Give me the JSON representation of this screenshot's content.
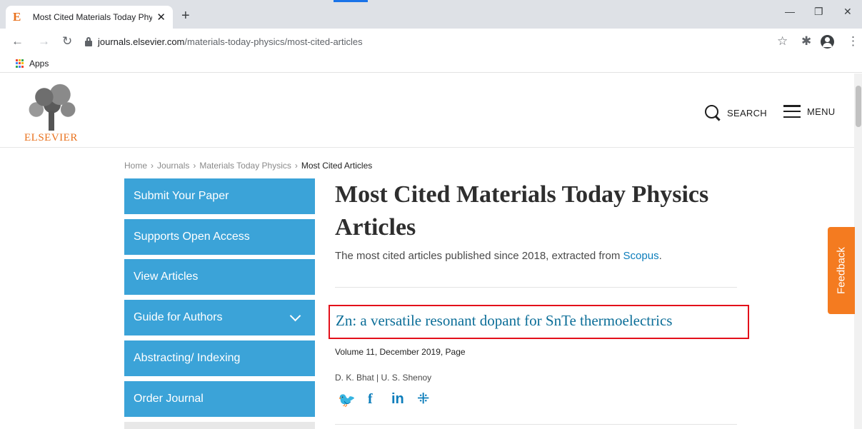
{
  "browser": {
    "tab_title": "Most Cited Materials Today Physi",
    "tab_favicon": "E",
    "new_tab": "+",
    "close": "✕",
    "url_host": "journals.elsevier.com",
    "url_path": "/materials-today-physics/most-cited-articles",
    "bookmark_apps": "Apps",
    "icons": [
      "back-arrow-icon",
      "forward-arrow-icon",
      "reload-icon",
      "lock-icon",
      "star-icon",
      "extensions-icon",
      "profile-icon",
      "more-icon"
    ]
  },
  "header": {
    "logo_text": "ELSEVIER",
    "search_label": "SEARCH",
    "menu_label": "MENU"
  },
  "breadcrumb": {
    "home": "Home",
    "journals": "Journals",
    "journal": "Materials Today Physics",
    "current": "Most Cited Articles",
    "separator": "›"
  },
  "sidebar": {
    "items": [
      {
        "label": "Submit Your Paper"
      },
      {
        "label": "Supports Open Access"
      },
      {
        "label": "View Articles"
      },
      {
        "label": "Guide for Authors"
      },
      {
        "label": "Abstracting/ Indexing"
      },
      {
        "label": "Order Journal"
      }
    ]
  },
  "main": {
    "title": "Most Cited Materials Today Physics Articles",
    "subtitle_prefix": "The most cited articles published since 2018, extracted from ",
    "subtitle_link": "Scopus",
    "subtitle_suffix": ".",
    "article": {
      "title": "Zn: a versatile resonant dopant for SnTe thermoelectrics",
      "volume": "Volume 11, December 2019, Page",
      "authors": "D. K. Bhat | U. S. Shenoy",
      "share": [
        "twitter-icon",
        "facebook-icon",
        "linkedin-icon",
        "mendeley-icon"
      ]
    }
  },
  "feedback_label": "Feedback",
  "colors": {
    "accent_blue": "#3ba3d8",
    "link_blue": "#0c7dbb",
    "highlight_red": "#e3101a",
    "feedback_orange": "#f47b20",
    "elsevier_orange": "#e9711c"
  }
}
